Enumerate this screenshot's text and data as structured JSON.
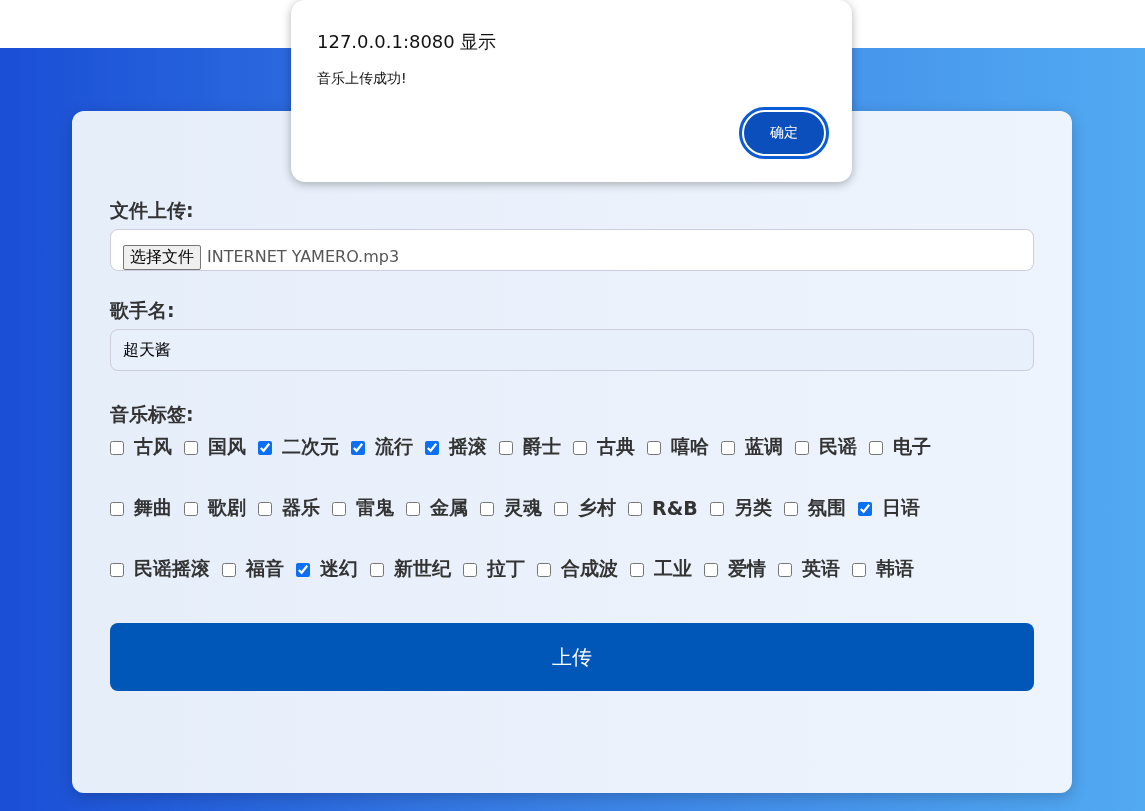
{
  "form": {
    "file": {
      "label": "文件上传:",
      "button": "选择文件",
      "filename": "INTERNET YAMERO.mp3"
    },
    "singer": {
      "label": "歌手名:",
      "value": "超天酱"
    },
    "tags_label": "音乐标签:",
    "tags": [
      {
        "label": "古风",
        "checked": false
      },
      {
        "label": "国风",
        "checked": false
      },
      {
        "label": "二次元",
        "checked": true
      },
      {
        "label": "流行",
        "checked": true
      },
      {
        "label": "摇滚",
        "checked": true
      },
      {
        "label": "爵士",
        "checked": false
      },
      {
        "label": "古典",
        "checked": false
      },
      {
        "label": "嘻哈",
        "checked": false
      },
      {
        "label": "蓝调",
        "checked": false
      },
      {
        "label": "民谣",
        "checked": false
      },
      {
        "label": "电子",
        "checked": false
      },
      {
        "label": "舞曲",
        "checked": false
      },
      {
        "label": "歌剧",
        "checked": false
      },
      {
        "label": "器乐",
        "checked": false
      },
      {
        "label": "雷鬼",
        "checked": false
      },
      {
        "label": "金属",
        "checked": false
      },
      {
        "label": "灵魂",
        "checked": false
      },
      {
        "label": "乡村",
        "checked": false
      },
      {
        "label": "R&B",
        "checked": false
      },
      {
        "label": "另类",
        "checked": false
      },
      {
        "label": "氛围",
        "checked": false
      },
      {
        "label": "日语",
        "checked": true
      },
      {
        "label": "民谣摇滚",
        "checked": false
      },
      {
        "label": "福音",
        "checked": false
      },
      {
        "label": "迷幻",
        "checked": true
      },
      {
        "label": "新世纪",
        "checked": false
      },
      {
        "label": "拉丁",
        "checked": false
      },
      {
        "label": "合成波",
        "checked": false
      },
      {
        "label": "工业",
        "checked": false
      },
      {
        "label": "爱情",
        "checked": false
      },
      {
        "label": "英语",
        "checked": false
      },
      {
        "label": "韩语",
        "checked": false
      }
    ],
    "submit": "上传"
  },
  "dialog": {
    "title": "127.0.0.1:8080 显示",
    "message": "音乐上传成功!",
    "ok": "确定"
  }
}
